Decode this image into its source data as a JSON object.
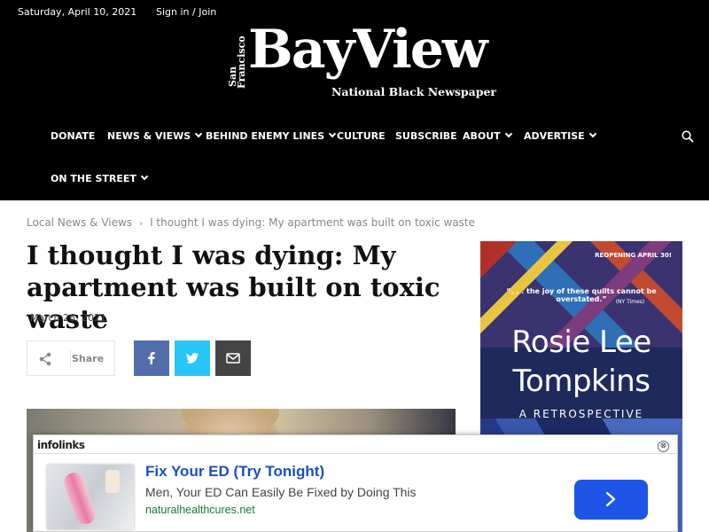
{
  "topbar": {
    "date": "Saturday, April 10, 2021",
    "signin": "Sign in / Join"
  },
  "logo": {
    "prefix_line1": "San",
    "prefix_line2": "Francisco",
    "name": "BayView",
    "tagline": "National Black Newspaper"
  },
  "nav": {
    "items": [
      {
        "label": "DONATE"
      },
      {
        "label": "NEWS & VIEWS"
      },
      {
        "label": "BEHIND ENEMY LINES"
      },
      {
        "label": "CULTURE"
      },
      {
        "label": "SUBSCRIBE"
      },
      {
        "label": "ABOUT"
      },
      {
        "label": "ADVERTISE"
      },
      {
        "label": "ON THE STREET"
      }
    ]
  },
  "breadcrumb": {
    "section": "Local News & Views",
    "current": "I thought I was dying: My apartment was built on toxic waste"
  },
  "article": {
    "title": "I thought I was dying: My apartment was built on toxic waste",
    "date": "March 26, 2021",
    "share_label": "Share"
  },
  "side_ad": {
    "reopen": "REOPENING APRIL 30!",
    "quote": "“. . . the joy of these quilts cannot be overstated.”",
    "source": "(NY Times)",
    "line1": "Rosie Lee",
    "line2": "Tompkins",
    "line3": "A RETROSPECTIVE"
  },
  "infolinks": {
    "brand": "infolinks",
    "close": "⊗",
    "headline": "Fix Your ED (Try Tonight)",
    "description": "Men, Your ED Can Easily Be Fixed by Doing This",
    "url": "naturalhealthcures.net"
  },
  "colors": {
    "header_bg": "#000000",
    "facebook": "#516eab",
    "twitter": "#29c5f6",
    "email": "#444444",
    "ad_link": "#1a4fc4",
    "ad_cta": "#1f55e6",
    "ad_url": "#1a7a2f"
  }
}
